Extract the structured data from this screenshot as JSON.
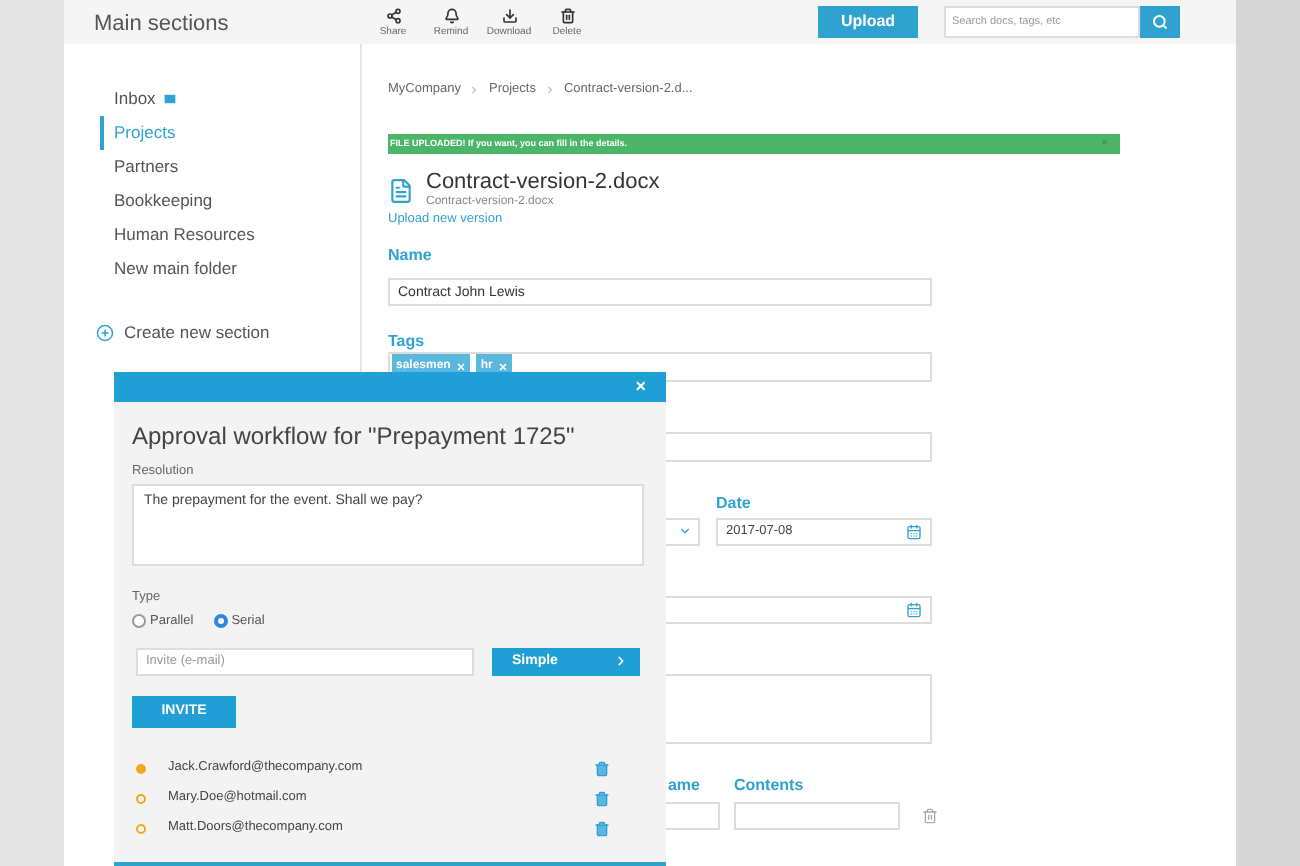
{
  "header": {
    "title": "Main sections",
    "toolbar": [
      {
        "kind": "share",
        "label": "Share"
      },
      {
        "kind": "remind",
        "label": "Remind"
      },
      {
        "kind": "download",
        "label": "Download"
      },
      {
        "kind": "delete",
        "label": "Delete"
      }
    ],
    "upload_button": "Upload",
    "search": {
      "placeholder": "Search docs, tags, etc"
    }
  },
  "sidebar": {
    "items": [
      {
        "label": "Inbox",
        "selected": false,
        "mail": true
      },
      {
        "label": "Projects",
        "selected": true,
        "mail": false
      },
      {
        "label": "Partners",
        "selected": false,
        "mail": false
      },
      {
        "label": "Bookkeeping",
        "selected": false,
        "mail": false
      },
      {
        "label": "Human Resources",
        "selected": false,
        "mail": false
      },
      {
        "label": "New main folder",
        "selected": false,
        "mail": false
      }
    ],
    "create": "Create new section"
  },
  "breadcrumb": [
    "MyCompany",
    "Projects",
    "Contract-version-2.d..."
  ],
  "banner": {
    "text": "FILE UPLOADED! If you want, you can fill in the details.",
    "close": "×"
  },
  "document": {
    "title": "Contract-version-2.docx",
    "filename": "Contract-version-2.docx",
    "upload_link": "Upload new version"
  },
  "form": {
    "name_label": "Name",
    "name_value": "Contract John Lewis",
    "tags_label": "Tags",
    "tags": [
      "salesmen",
      "hr"
    ],
    "date_label": "Date",
    "date_value": "2017-07-08",
    "name2_label": "ame",
    "contents_label": "Contents"
  },
  "modal": {
    "close": "×",
    "title": "Approval workflow for \"Prepayment 1725\"",
    "resolution_label": "Resolution",
    "resolution": "The prepayment for the event. Shall we pay?",
    "type_label": "Type",
    "types": [
      {
        "label": "Parallel",
        "selected": false
      },
      {
        "label": "Serial",
        "selected": true
      }
    ],
    "invite": {
      "placeholder": "Invite (e-mail)"
    },
    "mode_button": "Simple",
    "invite_button": "INVITE",
    "invitees": [
      {
        "email": "Jack.Crawford@thecompany.com",
        "current": true
      },
      {
        "email": "Mary.Doe@hotmail.com",
        "current": false
      },
      {
        "email": "Matt.Doors@thecompany.com",
        "current": false
      }
    ]
  }
}
